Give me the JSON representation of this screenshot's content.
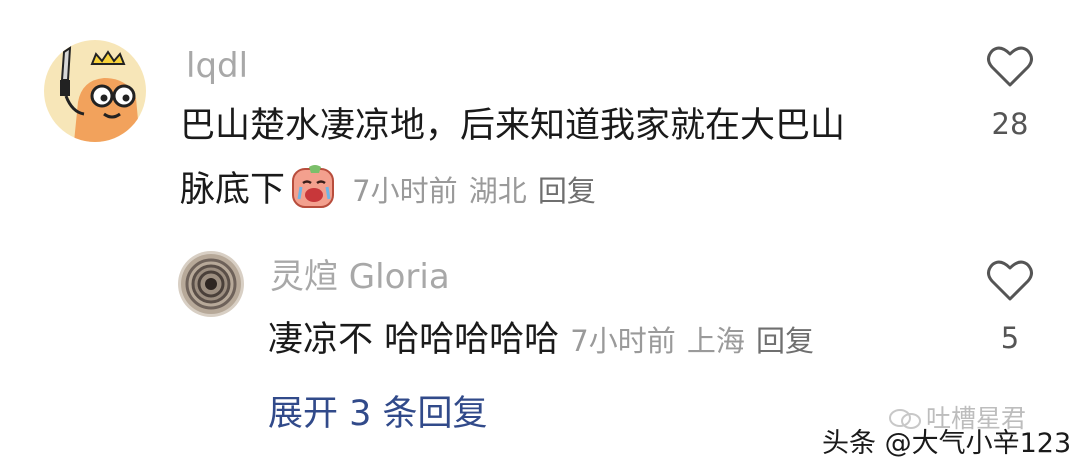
{
  "comment": {
    "username": "lqdl",
    "text_line1": "巴山楚水凄凉地，后来知道我家就在大巴山",
    "text_line2": "脉底下",
    "time": "7小时前",
    "location": "湖北",
    "reply_label": "回复",
    "like_count": "28"
  },
  "reply": {
    "username": "灵煊 Gloria",
    "text": "凄凉不 哈哈哈哈哈",
    "time": "7小时前",
    "location": "上海",
    "reply_label": "回复",
    "like_count": "5"
  },
  "expand_replies_label": "展开 3 条回复",
  "watermark": {
    "channel": "吐槽星君",
    "source": "头条 @大气小辛123"
  },
  "colors": {
    "username": "#a8a8a8",
    "text": "#1a1a1a",
    "meta": "#9a9a9a",
    "link": "#314a8a",
    "heart": "#555555"
  },
  "icons": {
    "like": "heart-outline-icon",
    "emoji": "crying-face-sticker",
    "watermark": "wechat-channel-icon"
  }
}
